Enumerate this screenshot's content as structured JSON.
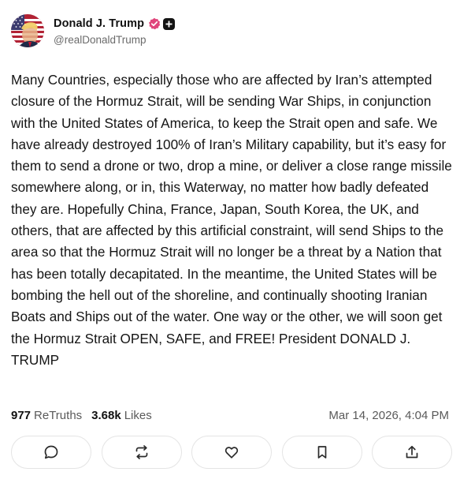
{
  "author": {
    "display_name": "Donald J. Trump",
    "handle": "@realDonaldTrump",
    "avatar_icon": "avatar-flag-portrait",
    "verified_icon": "verified-badge-icon",
    "verified_color": "#e0457b",
    "plus_icon": "plus-badge-icon"
  },
  "post": {
    "text": "Many Countries, especially those who are affected by Iran’s attempted closure of the Hormuz Strait, will be sending War Ships, in conjunction with the United States of America, to keep the Strait open and safe. We have already destroyed 100% of Iran’s Military capability, but it’s easy for them to send a drone or two, drop a mine, or deliver a close range missile somewhere along, or in, this Waterway, no matter how badly defeated they are. Hopefully China, France, Japan, South Korea, the UK, and others, that are affected by this artificial constraint, will send Ships to the area so that the Hormuz Strait will no longer be a threat by a Nation that has been totally decapitated. In the meantime, the United States will be bombing the hell out of the shoreline, and continually shooting Iranian Boats and Ships out of the water. One way or the other, we will soon get the Hormuz Strait OPEN, SAFE, and FREE! President DONALD J. TRUMP"
  },
  "stats": {
    "retruths_count": "977",
    "retruths_label": "ReTruths",
    "likes_count": "3.68k",
    "likes_label": "Likes",
    "timestamp": "Mar 14, 2026, 4:04 PM"
  },
  "actions": [
    {
      "name": "reply",
      "icon": "comment-icon"
    },
    {
      "name": "retruth",
      "icon": "repost-icon"
    },
    {
      "name": "like",
      "icon": "heart-icon"
    },
    {
      "name": "bookmark",
      "icon": "bookmark-icon"
    },
    {
      "name": "share",
      "icon": "share-icon"
    }
  ]
}
